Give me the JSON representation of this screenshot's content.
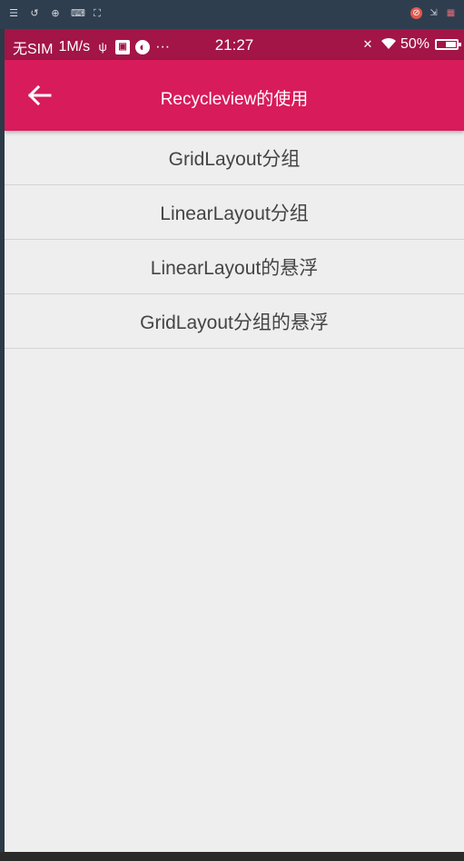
{
  "emulator_toolbar": {
    "tools": [
      "list-icon",
      "rotate-icon",
      "zoom-icon",
      "keyboard-icon",
      "fullscreen-icon"
    ],
    "right_tools": [
      "record-icon",
      "export-icon",
      "grid-icon"
    ]
  },
  "status_bar": {
    "carrier": "无SIM",
    "speed": "1M/s",
    "time": "21:27",
    "battery": "50%",
    "battery_level": 0.5,
    "more": "···"
  },
  "app_bar": {
    "title": "Recycleview的使用",
    "background": "#d81b5a"
  },
  "list": {
    "items": [
      {
        "label": "GridLayout分组"
      },
      {
        "label": "LinearLayout分组"
      },
      {
        "label": "LinearLayout的悬浮"
      },
      {
        "label": "GridLayout分组的悬浮"
      }
    ]
  },
  "colors": {
    "status_bar": "#a31447",
    "app_bar": "#d81b5a",
    "background": "#eeeeee",
    "text": "#444444"
  }
}
